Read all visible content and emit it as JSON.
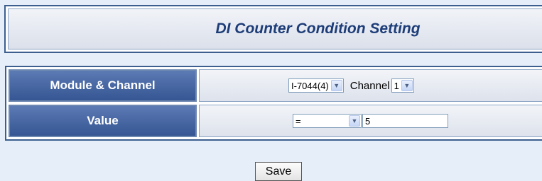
{
  "header": {
    "title": "DI Counter Condition Setting"
  },
  "form": {
    "module_channel": {
      "label": "Module & Channel",
      "module_value": "I-7044(4)",
      "channel_label": "Channel",
      "channel_value": "1"
    },
    "value": {
      "label": "Value",
      "operator": "=",
      "input_value": "5"
    }
  },
  "actions": {
    "save_label": "Save"
  },
  "icons": {
    "dropdown": "chevron-down-icon"
  },
  "colors": {
    "page_bg": "#e6eef9",
    "header_text": "#1d3d78",
    "label_cell_bg": "#4a6aa6",
    "border": "#3c5f8f"
  }
}
